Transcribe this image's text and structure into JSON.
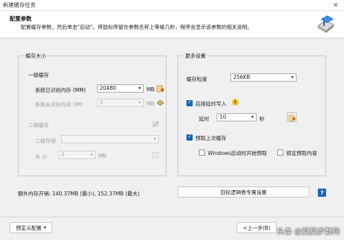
{
  "window": {
    "title": "新建缓存任务",
    "close_glyph": "×"
  },
  "header": {
    "title": "配置参数",
    "description": "配置缓存参数，然后单击\"启动\"。将鼠标停留在参数名称上等候几秒，程序会显示该参数的相关说明。"
  },
  "cache_size": {
    "group_label": "缓存大小",
    "level1_label": "一级缓存",
    "recognized_label": "系统已识别内存 (MM)",
    "recognized_value": "20480",
    "recognized_unit": "MB",
    "unrecognized_label": "系统未识别内存 (IM)",
    "unrecognized_value": "0",
    "unrecognized_unit": "MB",
    "level2_label": "二级缓存",
    "storage_label": "二级存储",
    "storage_value": "",
    "size_label": "大 小",
    "size_value": "0",
    "size_unit": "MB"
  },
  "more_settings": {
    "group_label": "更多设置",
    "granularity_label": "缓存粒度",
    "granularity_value": "256KB",
    "delay_write_label": "启用延时写入",
    "delay_write_checked": true,
    "delay_label": "延时",
    "delay_value": "10",
    "delay_unit": "秒",
    "prefetch_label": "预取上次缓存",
    "prefetch_checked": true,
    "windows_prefetch_label": "Windows启动时开始预取",
    "windows_prefetch_checked": false,
    "lock_prefetch_label": "锁定预取内容",
    "lock_prefetch_checked": false
  },
  "footer": {
    "overhead_text": "额外内存开销: 140.37MB (最小), 152.37MB (最大)",
    "target_button": "目标逻辑卷专属设置",
    "help_glyph": "?",
    "preset_button": "预定义配置",
    "back_button": "<上一步(B)",
    "watermark": "头条 @莫莫步数码"
  },
  "colors": {
    "accent": "#1565c0",
    "help": "#1e63c4"
  }
}
